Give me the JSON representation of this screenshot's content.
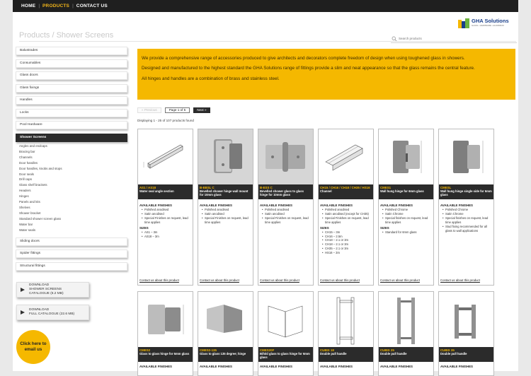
{
  "nav": {
    "items": [
      "HOME",
      "PRODUCTS",
      "CONTACT US"
    ],
    "active": "PRODUCTS"
  },
  "logo": {
    "name": "GHA Solutions",
    "tagline": "GLASS • HARDWARE • ALUMINIUM"
  },
  "page_title": "Products / Shower Screens",
  "search": {
    "placeholder": "Search products"
  },
  "sidebar": {
    "top_items": [
      "Balustrades",
      "Consumables",
      "Glass doors",
      "Glass fixings",
      "Handles",
      "Locks",
      "Pool Hardware",
      "Shower Screens"
    ],
    "active": "Shower Screens",
    "sub_items": [
      "Angles and endcaps",
      "Bracing bar",
      "Channels",
      "Door handles",
      "Door handles, knobs and stops",
      "Door seals",
      "Drill caps",
      "Glass shelf brackets",
      "Headers",
      "Hinges",
      "Panels and kits",
      "Shelves",
      "Shower bracket",
      "Standard shower screen glass",
      "Water bar",
      "Water seals"
    ],
    "bottom_items": [
      "Sliding doors",
      "Spider fittings",
      "Structural fittings"
    ]
  },
  "downloads": [
    {
      "line1": "DOWNLOAD",
      "line2": "SHOWER SCREENS",
      "line3": "CATALOGUE (6.2 MB)"
    },
    {
      "line1": "DOWNLOAD",
      "line2": "FULL CATALOGUE (22.6 MB)",
      "line3": ""
    }
  ],
  "email_button": {
    "line1": "Click here to",
    "line2": "email us"
  },
  "intro": {
    "p1": "We provide a comprehensive range of accessories produced to give architects and decorators complete freedom of design when using toughened glass in showers.",
    "p2": "Designed and manufactured to the highest standard the GHA Solutions range of fittings provide a slim and neat appearance so that the glass remains the central feature.",
    "p3": "All hinges and handles are a combination of brass and stainless steel."
  },
  "pager": {
    "prev": "« Previous",
    "current": "Page 1 of 5",
    "next": "Next »"
  },
  "showing": "Displaying 1 - 25 of 107 products found",
  "products": [
    {
      "code": "AS1 / AS18",
      "desc": "Water seal angle section",
      "finishes_label": "AVAILABLE FINISHES",
      "finishes": [
        "Polished anodised",
        "Satin anodised",
        "Special Finishes on request, lead time applies"
      ],
      "sizes_label": "SIZES",
      "sizes": [
        "AS1 – 3m",
        "AS18 – 3m"
      ],
      "contact": "Contact us about this product"
    },
    {
      "code": "B-EBSL C",
      "desc": "Bevelled shower hinge wall mount for 10mm glass",
      "finishes_label": "AVAILABLE FINISHES",
      "finishes": [
        "Polished anodised",
        "Satin anodised",
        "Special Finishes on request, lead time applies"
      ],
      "sizes_label": "",
      "sizes": [],
      "contact": "Contact us about this product"
    },
    {
      "code": "B-ESS C",
      "desc": "Bevelled shower glass to glass hinge for 10mm glass",
      "finishes_label": "AVAILABLE FINISHES",
      "finishes": [
        "Polished anodised",
        "Satin anodised",
        "Special Finishes on request, lead time applies"
      ],
      "sizes_label": "",
      "sizes": [],
      "contact": "Contact us about this product"
    },
    {
      "code": "CH15 / CH16 / CH18 / CH35 / HS16",
      "desc": "Channel",
      "finishes_label": "AVAILABLE FINISHES",
      "finishes": [
        "Polished anodised",
        "Satin anodised (except for CH35)",
        "Special Finishes on request, lead time applies"
      ],
      "sizes_label": "SIZES",
      "sizes": [
        "CH15 – 3m",
        "CH16 – 2.5m",
        "CH18 – 2.1 or 3m",
        "CH18 – 2.1 or 3m",
        "CH35 – 2.1 or 3m",
        "HS16 – 3m"
      ],
      "contact": "Contact us about this product"
    },
    {
      "code": "CMES1",
      "desc": "Wall hung hinge for 6mm glass",
      "finishes_label": "AVAILABLE FINISHES",
      "finishes": [
        "Polished Chrome",
        "Satin Chrome",
        "Special finishes on request, lead time applies"
      ],
      "sizes_label": "SIZES",
      "sizes": [
        "Standard for 6mm glass"
      ],
      "contact": "Contact us about this product"
    },
    {
      "code": "CMESL",
      "desc": "Wall hung hinge single side for 6mm glass",
      "finishes_label": "AVAILABLE FINISHES",
      "finishes": [
        "Polished Chrome",
        "Satin Chrome",
        "Special finishes on request, lead time applies",
        "Stud fixing recommended for all glass to wall applications"
      ],
      "sizes_label": "",
      "sizes": [],
      "contact": "Contact us about this product"
    }
  ],
  "products_row2": [
    {
      "code": "CMES2",
      "desc": "Glass to glass hinge for 6mm glass",
      "finishes_label": "AVAILABLE FINISHES"
    },
    {
      "code": "CMES2-135",
      "desc": "Glass to glass 135 degree; hinge",
      "finishes_label": "AVAILABLE FINISHES"
    },
    {
      "code": "CMES20F",
      "desc": "Bifold glass to glass hinge for 6mm glass",
      "finishes_label": "AVAILABLE FINISHES"
    },
    {
      "code": "CUBIX 18",
      "desc": "Double pull handle",
      "finishes_label": "AVAILABLE FINISHES"
    },
    {
      "code": "CUBIX 25",
      "desc": "Double pull handle",
      "finishes_label": "AVAILABLE FINISHES"
    },
    {
      "code": "CUBIX 35",
      "desc": "Double pull handle",
      "finishes_label": "AVAILABLE FINISHES"
    }
  ],
  "colors": {
    "accent": "#f5b800",
    "dark": "#2b2b2b",
    "nav_bg": "#1f1f1f",
    "logo_blue": "#1a3f8a",
    "logo_green": "#6cb33f"
  }
}
